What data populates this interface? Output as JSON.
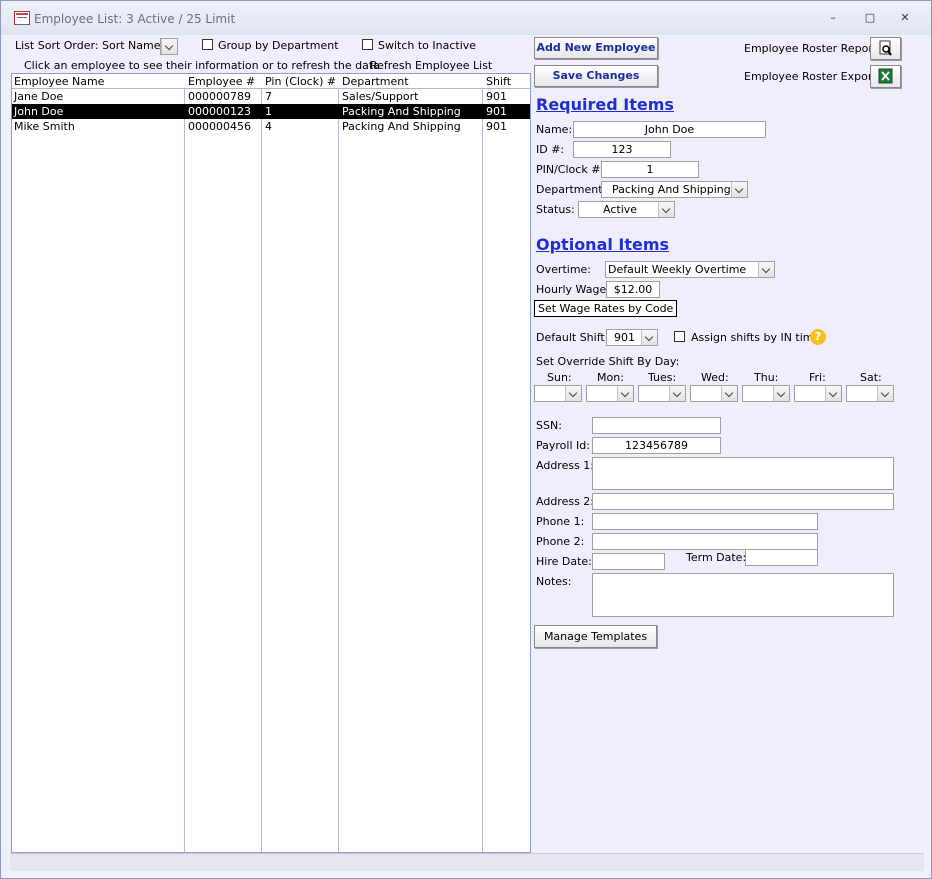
{
  "window": {
    "title": "Employee List: 3 Active / 25 Limit",
    "minimize": "–",
    "maximize": "□",
    "close": "✕"
  },
  "toolbar": {
    "sort_label": "List Sort Order:",
    "sort_value": "Sort Name",
    "group_by_dept": "Group by Department",
    "switch_inactive": "Switch to Inactive",
    "hint": "Click an employee to see their information or to refresh the data",
    "refresh": "Refresh Employee List"
  },
  "list": {
    "columns": [
      "Employee Name",
      "Employee #",
      "Pin (Clock) #",
      "Department",
      "Shift"
    ],
    "rows": [
      {
        "name": "Jane Doe",
        "num": "000000789",
        "pin": "7",
        "dept": "Sales/Support",
        "shift": "901"
      },
      {
        "name": "John Doe",
        "num": "000000123",
        "pin": "1",
        "dept": "Packing And Shipping",
        "shift": "901"
      },
      {
        "name": "Mike Smith",
        "num": "000000456",
        "pin": "4",
        "dept": "Packing And Shipping",
        "shift": "901"
      }
    ]
  },
  "actions": {
    "add_employee": "Add New Employee",
    "save_changes": "Save Changes",
    "roster_report": "Employee Roster Report",
    "roster_export": "Employee Roster Export"
  },
  "required": {
    "heading": "Required Items",
    "name_label": "Name:",
    "name_value": "John Doe",
    "id_label": "ID #:",
    "id_value": "123",
    "pin_label": "PIN/Clock #:",
    "pin_value": "1",
    "dept_label": "Department:",
    "dept_value": "Packing And Shipping",
    "status_label": "Status:",
    "status_value": "Active"
  },
  "optional": {
    "heading": "Optional Items",
    "overtime_label": "Overtime:",
    "overtime_value": "Default Weekly Overtime",
    "wage_label": "Hourly Wage:",
    "wage_value": "$12.00",
    "wage_codes": "Set Wage Rates by Code",
    "shift_label": "Default Shift:",
    "shift_value": "901",
    "assign_in_time": "Assign shifts by IN time",
    "help": "?",
    "override_label": "Set Override Shift By Day:",
    "days": [
      "Sun:",
      "Mon:",
      "Tues:",
      "Wed:",
      "Thu:",
      "Fri:",
      "Sat:"
    ],
    "ssn_label": "SSN:",
    "ssn_value": "",
    "payroll_label": "Payroll Id:",
    "payroll_value": "123456789",
    "addr1_label": "Address 1:",
    "addr2_label": "Address 2:",
    "phone1_label": "Phone 1:",
    "phone2_label": "Phone 2:",
    "hire_label": "Hire Date:",
    "term_label": "Term Date:",
    "notes_label": "Notes:",
    "manage_templates": "Manage Templates"
  },
  "colors": {
    "accent": "#1e2ed2",
    "selection": "#000000",
    "background": "#f0eefc"
  },
  "icons": {
    "report": "magnifier-page-icon",
    "export": "excel-icon",
    "help": "question-icon"
  }
}
